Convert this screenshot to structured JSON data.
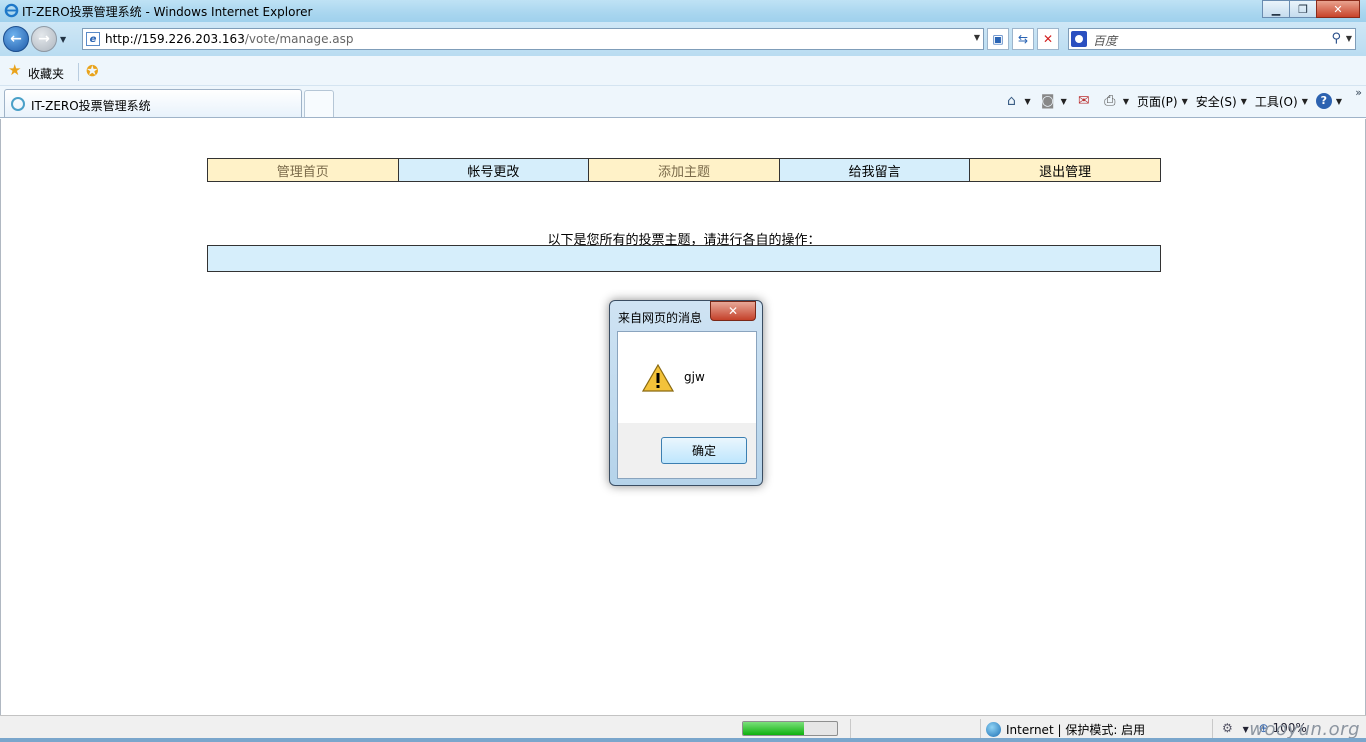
{
  "window": {
    "title": "IT-ZERO投票管理系统 - Windows Internet Explorer"
  },
  "address_bar": {
    "url_host": "http://159.226.203.163",
    "url_path": "/vote/manage.asp"
  },
  "search": {
    "placeholder": "百度"
  },
  "favorites": {
    "label": "收藏夹"
  },
  "tab": {
    "title": "IT-ZERO投票管理系统"
  },
  "command_bar": {
    "page": "页面(P)",
    "safety": "安全(S)",
    "tools": "工具(O)"
  },
  "page": {
    "nav": [
      {
        "label": "管理首页"
      },
      {
        "label": "帐号更改"
      },
      {
        "label": "添加主题"
      },
      {
        "label": "给我留言"
      },
      {
        "label": "退出管理"
      }
    ],
    "intro": "以下是您所有的投票主题，请进行各自的操作："
  },
  "dialog": {
    "title": "来自网页的消息",
    "message": "gjw",
    "ok": "确定"
  },
  "status": {
    "progress": 0.65,
    "zone": "Internet | 保护模式: 启用",
    "zoom": "100%",
    "watermark": "wooyun.org"
  }
}
